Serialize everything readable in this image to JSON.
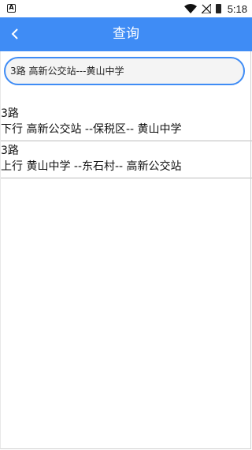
{
  "status_bar": {
    "left_icon_label": "A",
    "time": "5:18",
    "icons": [
      "notification-icon",
      "wifi-icon",
      "signal-icon",
      "battery-icon"
    ]
  },
  "header": {
    "title": "查询",
    "back_icon": "chevron-left-icon",
    "color": "#3f8cf5"
  },
  "search": {
    "value": "3路  高新公交站---黄山中学"
  },
  "results": [
    {
      "route": "3路",
      "stops": "下行 高新公交站 --保税区-- 黄山中学"
    },
    {
      "route": "3路",
      "stops": "上行 黄山中学 --东石村-- 高新公交站"
    }
  ]
}
